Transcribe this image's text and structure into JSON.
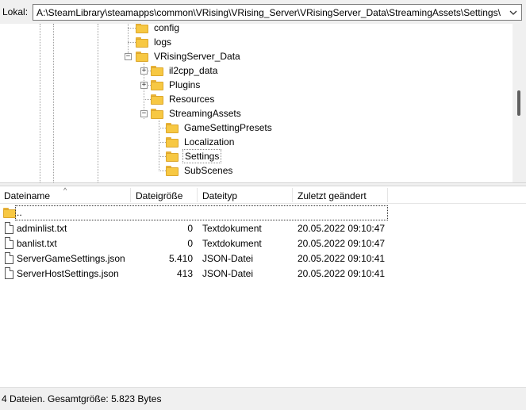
{
  "pathbar": {
    "label": "Lokal:",
    "path": "A:\\SteamLibrary\\steamapps\\common\\VRising\\VRising_Server\\VRisingServer_Data\\StreamingAssets\\Settings\\"
  },
  "tree": {
    "items": [
      {
        "label": "config"
      },
      {
        "label": "logs"
      },
      {
        "label": "VRisingServer_Data"
      },
      {
        "label": "il2cpp_data"
      },
      {
        "label": "Plugins"
      },
      {
        "label": "Resources"
      },
      {
        "label": "StreamingAssets"
      },
      {
        "label": "GameSettingPresets"
      },
      {
        "label": "Localization"
      },
      {
        "label": "Settings"
      },
      {
        "label": "SubScenes"
      }
    ],
    "expanders": {
      "minus": "−",
      "plus": "+"
    }
  },
  "filelist": {
    "columns": {
      "name": "Dateiname",
      "size": "Dateigröße",
      "type": "Dateityp",
      "modified": "Zuletzt geändert"
    },
    "sort_indicator": "^",
    "updir_label": "..",
    "rows": [
      {
        "name": "adminlist.txt",
        "size": "0",
        "type": "Textdokument",
        "modified": "20.05.2022 09:10:47"
      },
      {
        "name": "banlist.txt",
        "size": "0",
        "type": "Textdokument",
        "modified": "20.05.2022 09:10:47"
      },
      {
        "name": "ServerGameSettings.json",
        "size": "5.410",
        "type": "JSON-Datei",
        "modified": "20.05.2022 09:10:41"
      },
      {
        "name": "ServerHostSettings.json",
        "size": "413",
        "type": "JSON-Datei",
        "modified": "20.05.2022 09:10:41"
      }
    ]
  },
  "statusbar": {
    "text": "4 Dateien. Gesamtgröße: 5.823 Bytes"
  },
  "colors": {
    "folder": "#f7c843",
    "folder_border": "#dca72d",
    "chrome": "#f0f0f0"
  }
}
